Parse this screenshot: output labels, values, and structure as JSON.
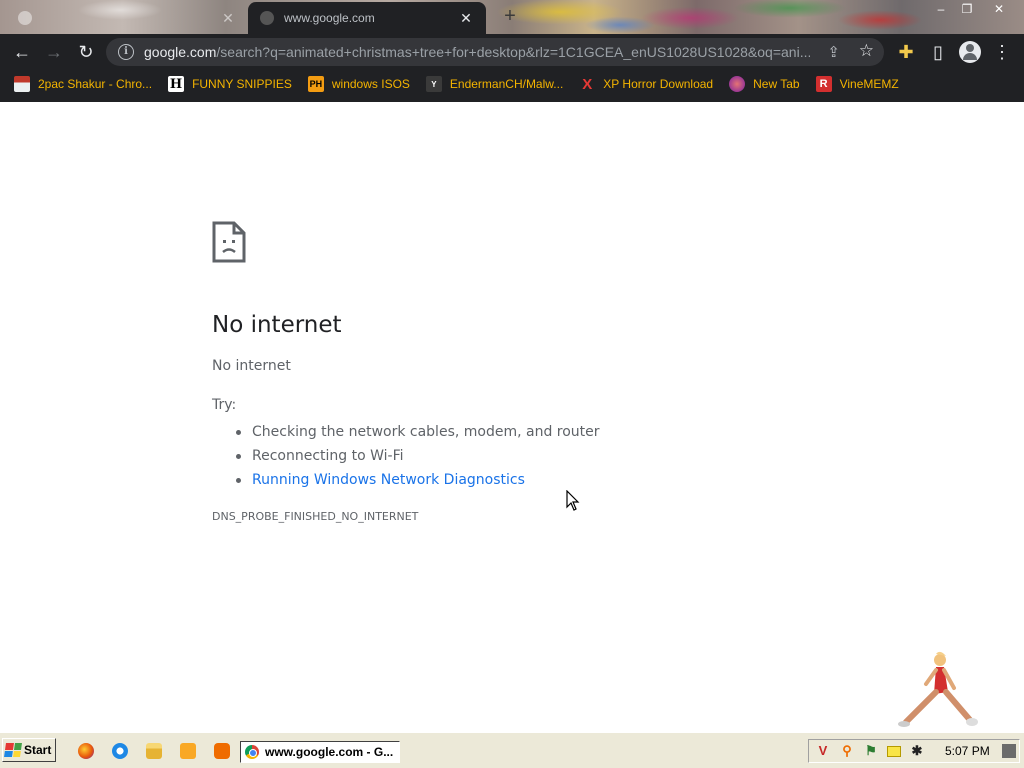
{
  "browser": {
    "tabs": [
      {
        "title": "",
        "active": false
      },
      {
        "title": "www.google.com",
        "active": true
      }
    ],
    "address_bar": {
      "host": "google.com",
      "path": "/search?q=animated+christmas+tree+for+desktop&rlz=1C1GCEA_enUS1028US1028&oq=ani..."
    },
    "bookmarks": [
      {
        "label": "2pac Shakur - Chro...",
        "icon": "2pac-icon"
      },
      {
        "label": "FUNNY SNIPPIES",
        "icon": "h-icon",
        "glyph": "H"
      },
      {
        "label": "windows ISOS",
        "icon": "ph-icon",
        "glyph": "PH"
      },
      {
        "label": "EndermanCH/Malw...",
        "icon": "youtube-icon",
        "glyph": "Y"
      },
      {
        "label": "XP Horror Download",
        "icon": "x-icon",
        "glyph": "X"
      },
      {
        "label": "New Tab",
        "icon": "globe-icon"
      },
      {
        "label": "VineMEMZ",
        "icon": "r-icon",
        "glyph": "R"
      }
    ]
  },
  "error_page": {
    "heading": "No internet",
    "subheading": "No internet",
    "try_label": "Try:",
    "suggestions": [
      "Checking the network cables, modem, and router",
      "Reconnecting to Wi-Fi",
      "Running Windows Network Diagnostics"
    ],
    "error_code": "DNS_PROBE_FINISHED_NO_INTERNET"
  },
  "taskbar": {
    "start_label": "Start",
    "active_window": "www.google.com - G...",
    "clock": "5:07 PM"
  },
  "colors": {
    "chrome_dark": "#202124",
    "bookmark_text": "#f4b400",
    "link_blue": "#1a73e8",
    "taskbar": "#ece9d8"
  }
}
